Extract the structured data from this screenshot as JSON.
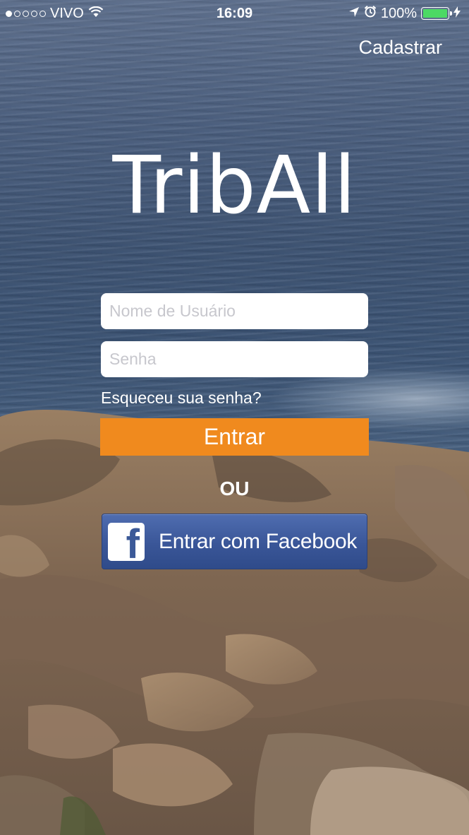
{
  "status_bar": {
    "carrier": "VIVO",
    "time": "16:09",
    "battery": "100%",
    "signal_bars_filled": 1,
    "signal_bars_total": 5
  },
  "header": {
    "register_label": "Cadastrar"
  },
  "logo": {
    "text": "TribAll"
  },
  "login_form": {
    "username_placeholder": "Nome de Usuário",
    "password_placeholder": "Senha",
    "forgot_password_label": "Esqueceu sua senha?",
    "login_button_label": "Entrar",
    "separator": "OU",
    "facebook_button_label": "Entrar com Facebook",
    "facebook_icon_glyph": "f"
  },
  "colors": {
    "login_button": "#f08a1e",
    "facebook_button": "#3a5698",
    "battery_fill": "#4cd964"
  }
}
